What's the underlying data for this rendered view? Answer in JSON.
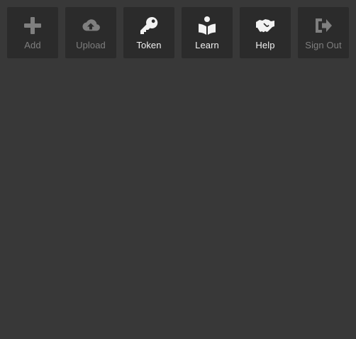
{
  "toolbar": {
    "add": {
      "label": "Add",
      "icon": "plus-icon",
      "enabled": false
    },
    "upload": {
      "label": "Upload",
      "icon": "cloud-upload-icon",
      "enabled": false
    },
    "token": {
      "label": "Token",
      "icon": "key-icon",
      "enabled": true
    },
    "learn": {
      "label": "Learn",
      "icon": "book-reader-icon",
      "enabled": true
    },
    "help": {
      "label": "Help",
      "icon": "handshake-icon",
      "enabled": true
    },
    "signout": {
      "label": "Sign Out",
      "icon": "sign-out-icon",
      "enabled": false
    }
  },
  "colors": {
    "background": "#383838",
    "button": "#2b2b2b",
    "enabled_text": "#f2f2f2",
    "disabled_text": "#7f7f7f"
  }
}
